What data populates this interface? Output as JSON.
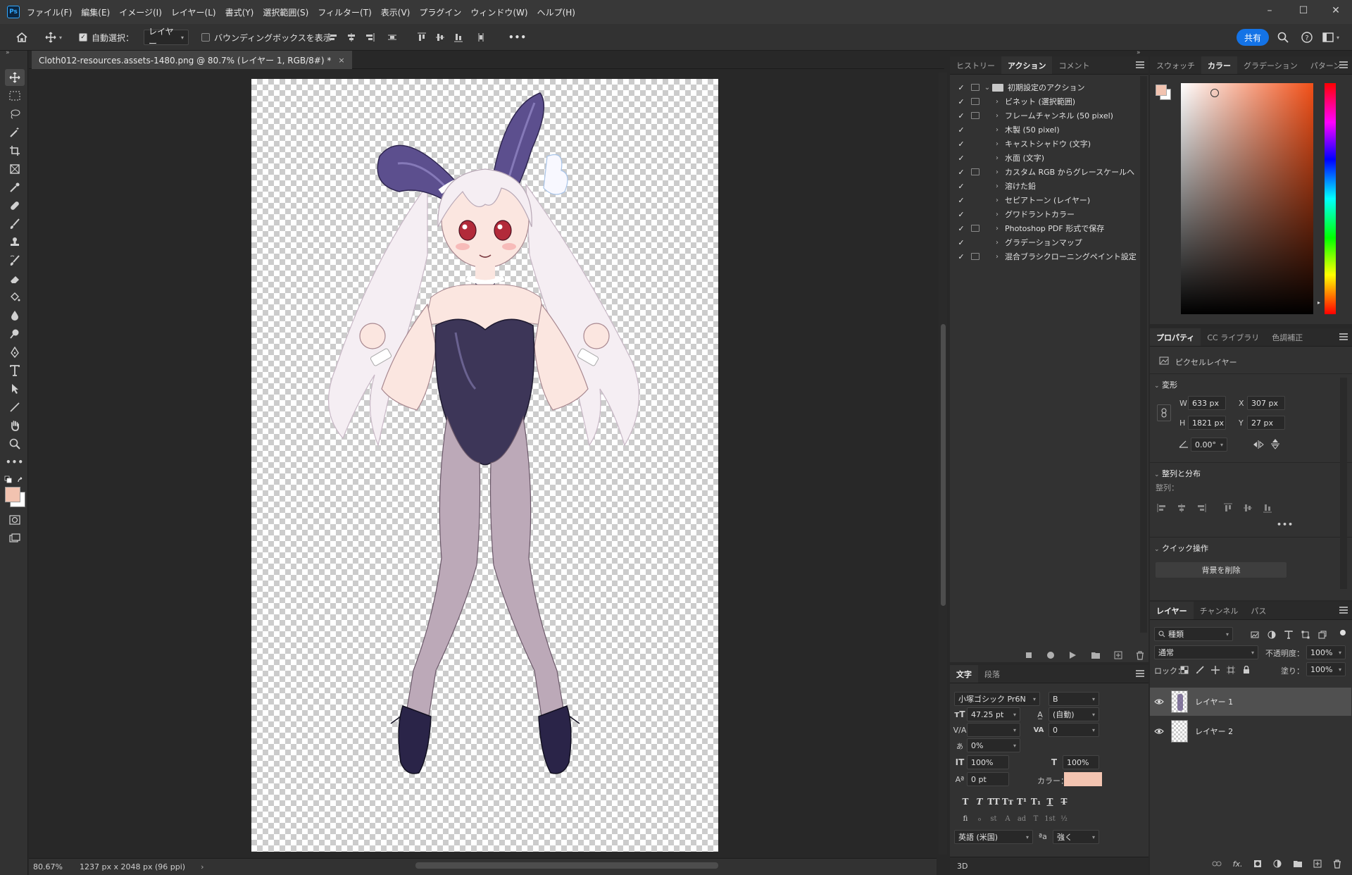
{
  "app": {
    "logo": "Ps"
  },
  "menubar": [
    "ファイル(F)",
    "編集(E)",
    "イメージ(I)",
    "レイヤー(L)",
    "書式(Y)",
    "選択範囲(S)",
    "フィルター(T)",
    "表示(V)",
    "プラグイン",
    "ウィンドウ(W)",
    "ヘルプ(H)"
  ],
  "window_controls": {
    "minimize": "–",
    "maximize": "☐",
    "close": "✕"
  },
  "options": {
    "auto_select_label": "自動選択：",
    "auto_select_checked": true,
    "auto_select_target": "レイヤー",
    "bounding_box_label": "バウンディングボックスを表示",
    "bounding_box_checked": false,
    "more": "•••",
    "share": "共有"
  },
  "document": {
    "tab_title": "Cloth012-resources.assets-1480.png @ 80.7% (レイヤー 1, RGB/8#) *",
    "close": "×",
    "zoom": "80.67%",
    "doc_info": "1237 px x 2048 px (96 ppi)",
    "arrow": "›"
  },
  "colors": {
    "foreground": "#f2c3b0",
    "background": "#ffffff",
    "accent": "#1473e6"
  },
  "actions_panel": {
    "tabs": [
      "ヒストリー",
      "アクション",
      "コメント"
    ],
    "active_tab": 1,
    "set_name": "初期設定のアクション",
    "items": [
      {
        "label": "ビネット (選択範囲)",
        "dialog": true
      },
      {
        "label": "フレームチャンネル (50 pixel)",
        "dialog": true
      },
      {
        "label": "木製 (50 pixel)",
        "dialog": false
      },
      {
        "label": "キャストシャドウ (文字)",
        "dialog": false
      },
      {
        "label": "水面 (文字)",
        "dialog": false
      },
      {
        "label": "カスタム RGB からグレースケールへ",
        "dialog": true
      },
      {
        "label": "溶けた鉛",
        "dialog": false
      },
      {
        "label": "セピアトーン (レイヤー)",
        "dialog": false
      },
      {
        "label": "グワドラントカラー",
        "dialog": false
      },
      {
        "label": "Photoshop PDF 形式で保存",
        "dialog": true
      },
      {
        "label": "グラデーションマップ",
        "dialog": false
      },
      {
        "label": "混合ブラシクローニングペイント設定",
        "dialog": true
      }
    ]
  },
  "character_panel": {
    "tabs": [
      "文字",
      "段落"
    ],
    "font_family": "小塚ゴシック Pr6N",
    "font_style": "B",
    "font_size": "47.25 pt",
    "leading": "(自動)",
    "kerning": "",
    "tracking": "0",
    "tsume": "0%",
    "vscale": "100%",
    "hscale": "100%",
    "baseline": "0 pt",
    "color_label": "カラー：",
    "color": "#f3c4b1",
    "language": "英語 (米国)",
    "aa_symbol": "ªa",
    "antialias": "強く",
    "style_buttons": [
      "T",
      "T",
      "TT",
      "Tт",
      "T¹",
      "T₁",
      "T",
      "T"
    ],
    "opentype_buttons": [
      "fi",
      "ℴ",
      "st",
      "A",
      "ad",
      "T",
      "1st",
      "½"
    ]
  },
  "color_panel": {
    "tabs": [
      "スウォッチ",
      "カラー",
      "グラデーション",
      "パターン"
    ],
    "active_tab": 1,
    "hue_color": "#f25018"
  },
  "properties_panel": {
    "tabs": [
      "プロパティ",
      "CC ライブラリ",
      "色調補正"
    ],
    "type": "ピクセルレイヤー",
    "transform_title": "変形",
    "w_label": "W",
    "w": "633 px",
    "x_label": "X",
    "x": "307 px",
    "h_label": "H",
    "h": "1821 px",
    "y_label": "Y",
    "y": "27 px",
    "angle": "0.00°",
    "align_title": "整列と分布",
    "align_label": "整列：",
    "quick_title": "クイック操作",
    "remove_bg": "背景を削除",
    "more": "•••"
  },
  "layers_panel": {
    "tabs": [
      "レイヤー",
      "チャンネル",
      "パス"
    ],
    "filter": "種類",
    "blend_mode": "通常",
    "opacity_label": "不透明度：",
    "opacity": "100%",
    "lock_label": "ロック：",
    "fill_label": "塗り：",
    "fill": "100%",
    "layers": [
      {
        "name": "レイヤー 1",
        "selected": true
      },
      {
        "name": "レイヤー 2",
        "selected": false
      }
    ]
  },
  "threed_tab": "3D"
}
